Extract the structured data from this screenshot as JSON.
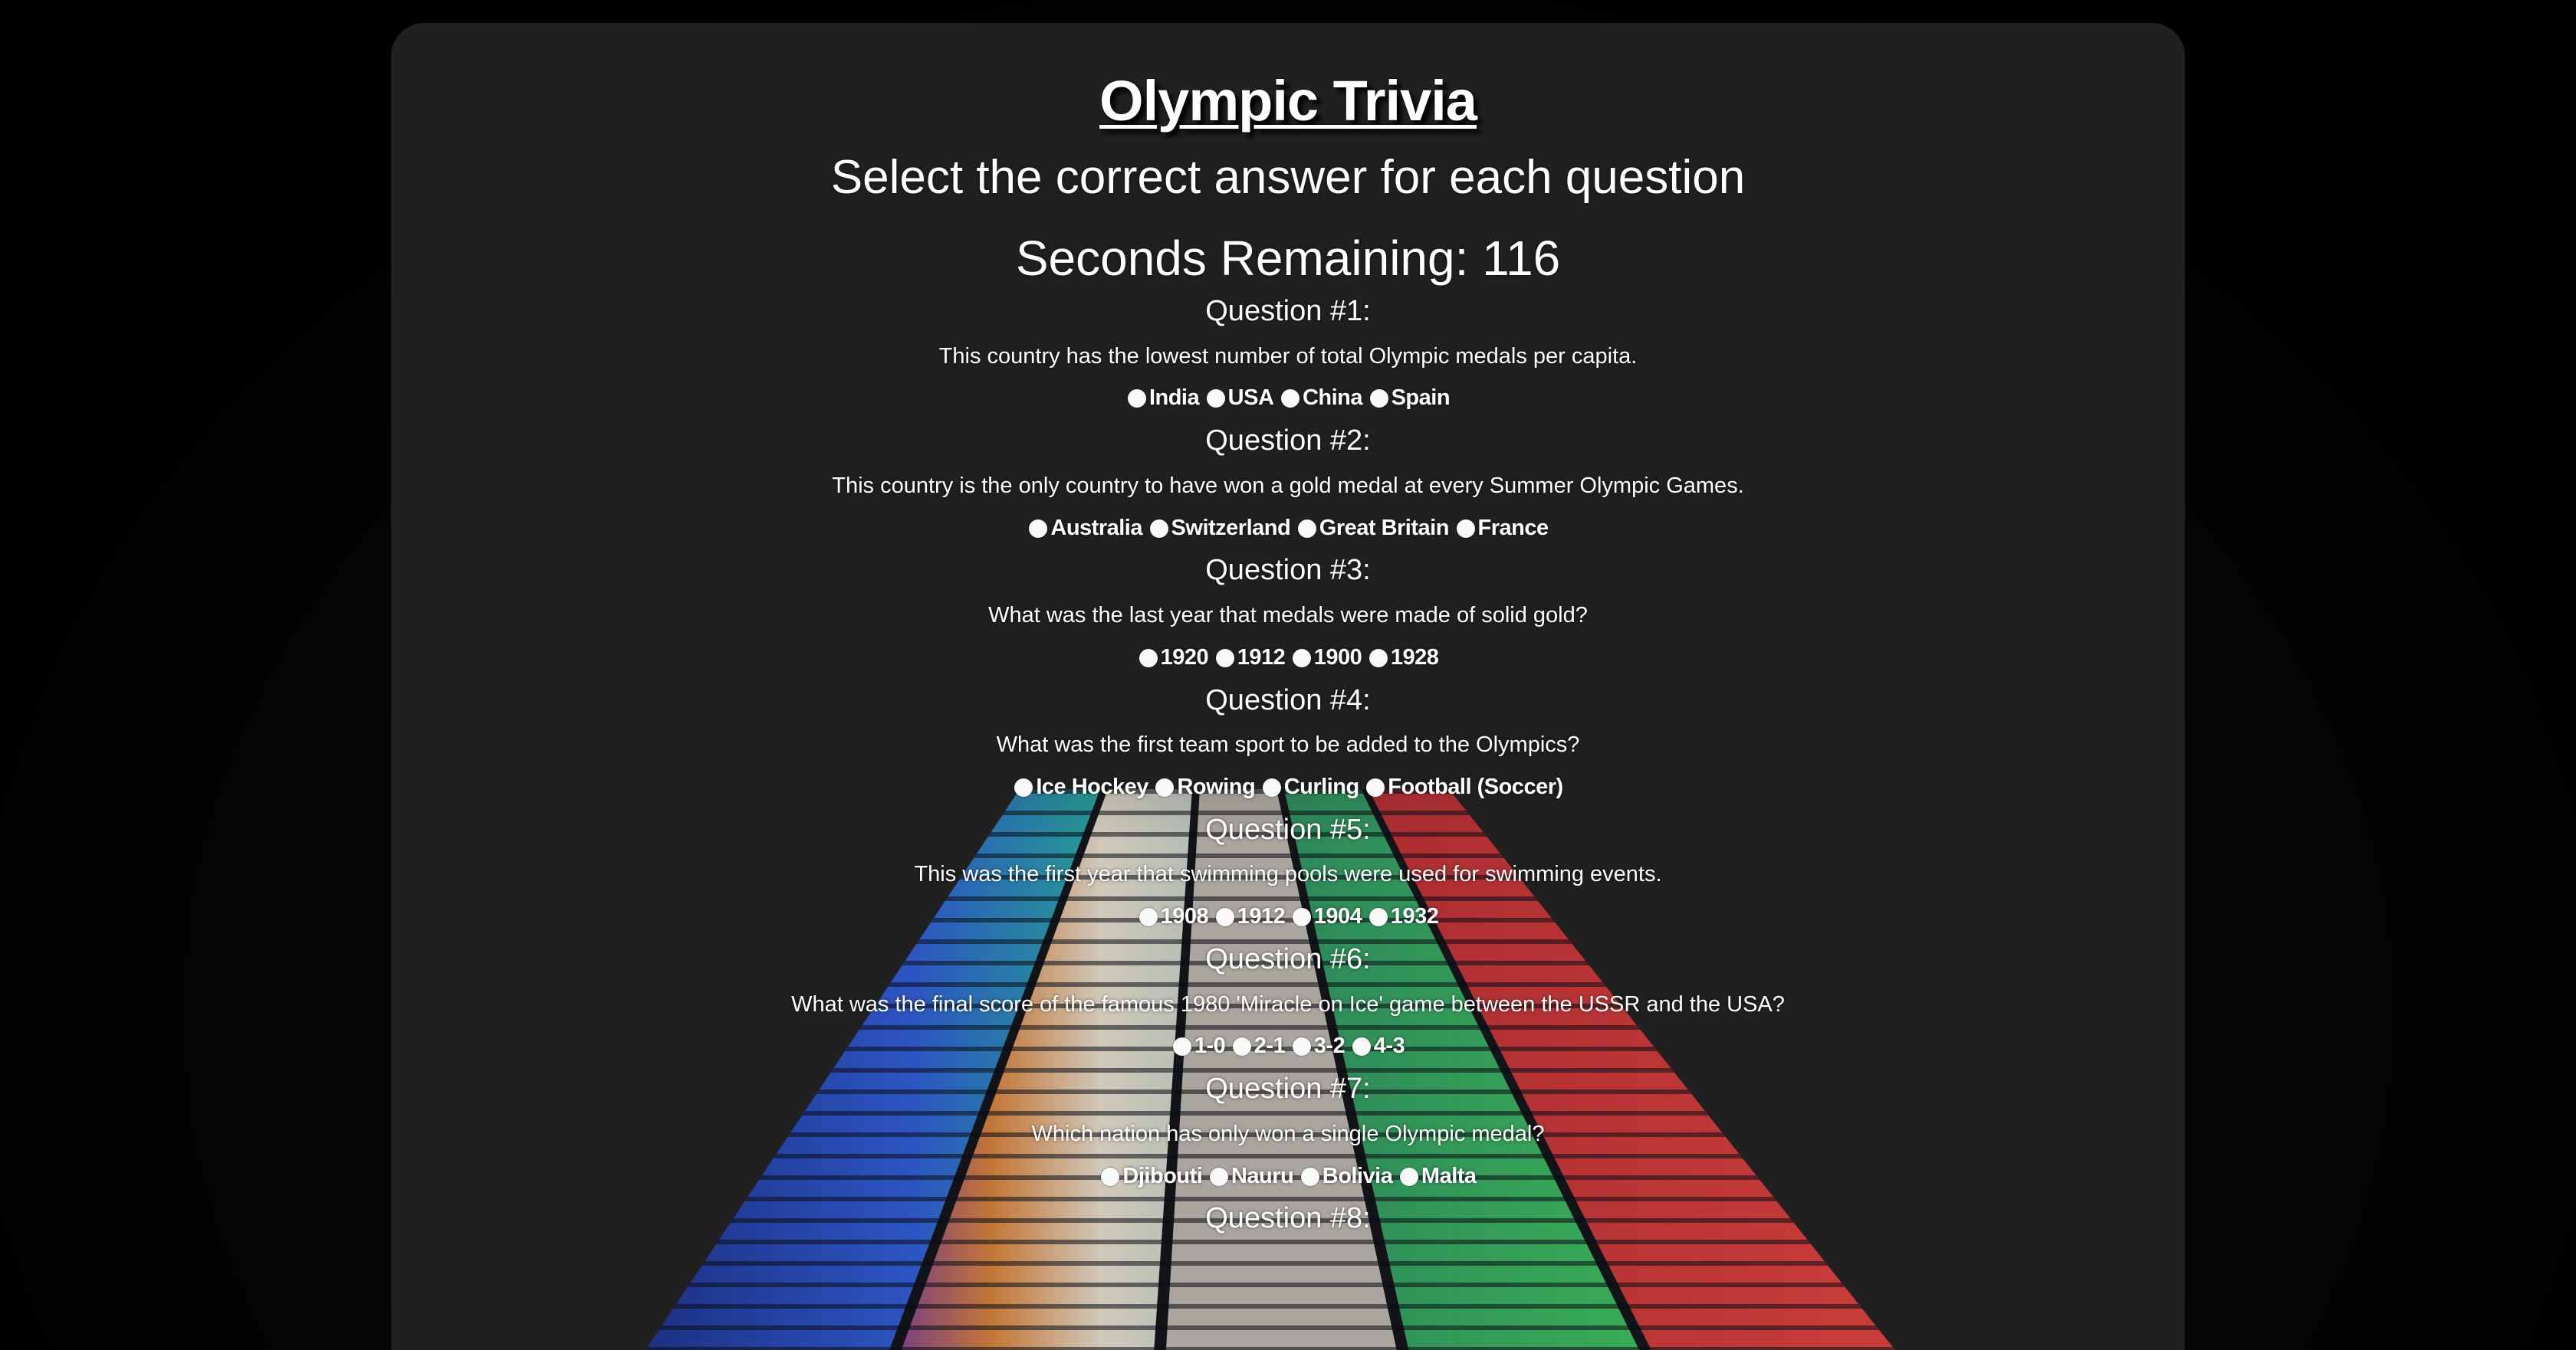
{
  "header": {
    "title": "Olympic Trivia",
    "subtitle": "Select the correct answer for each question",
    "timer_text": "Seconds Remaining: 116"
  },
  "questions": [
    {
      "heading": "Question #1:",
      "text": "This country has the lowest number of total Olympic medals per capita.",
      "options": [
        "India",
        "USA",
        "China",
        "Spain"
      ]
    },
    {
      "heading": "Question #2:",
      "text": "This country is the only country to have won a gold medal at every Summer Olympic Games.",
      "options": [
        "Australia",
        "Switzerland",
        "Great Britain",
        "France"
      ]
    },
    {
      "heading": "Question #3:",
      "text": "What was the last year that medals were made of solid gold?",
      "options": [
        "1920",
        "1912",
        "1900",
        "1928"
      ]
    },
    {
      "heading": "Question #4:",
      "text": "What was the first team sport to be added to the Olympics?",
      "options": [
        "Ice Hockey",
        "Rowing",
        "Curling",
        "Football (Soccer)"
      ]
    },
    {
      "heading": "Question #5:",
      "text": "This was the first year that swimming pools were used for swimming events.",
      "options": [
        "1908",
        "1912",
        "1904",
        "1932"
      ]
    },
    {
      "heading": "Question #6:",
      "text": "What was the final score of the famous 1980 'Miracle on Ice' game between the USSR and the USA?",
      "options": [
        "1-0",
        "2-1",
        "3-2",
        "4-3"
      ]
    },
    {
      "heading": "Question #7:",
      "text": "Which nation has only won a single Olympic medal?",
      "options": [
        "Djibouti",
        "Nauru",
        "Bolivia",
        "Malta"
      ]
    },
    {
      "heading": "Question #8:",
      "text": "",
      "options": []
    }
  ],
  "colors": {
    "page_background": "#000000",
    "panel_background": "#202020",
    "text": "#ffffff",
    "radio_fill": "#fafafa",
    "stripe_blue": "#2a4fd6",
    "stripe_teal": "#1fb89a",
    "stripe_orange": "#e08a3a",
    "stripe_white": "#e8e2d8",
    "stripe_green": "#3fbf5a",
    "stripe_red": "#e0353a"
  },
  "background_image": "olympic-rainbow-tower-photo"
}
